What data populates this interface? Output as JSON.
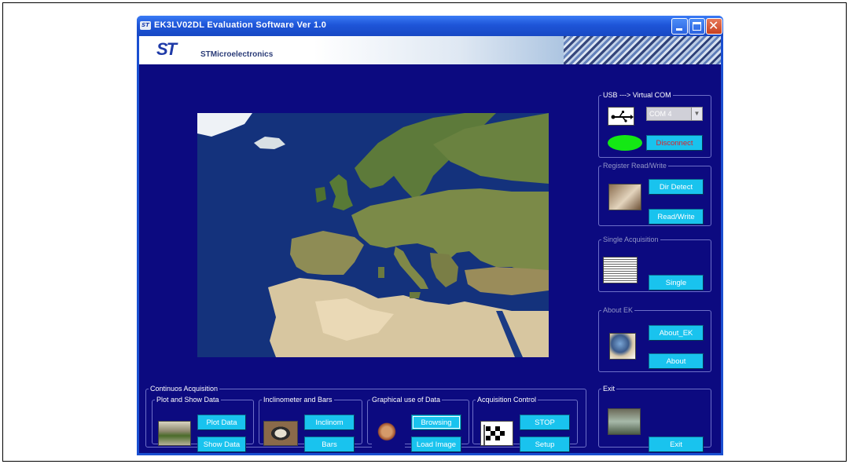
{
  "window": {
    "title": "EK3LV02DL Evaluation Software Ver 1.0",
    "app_icon_text": "ST"
  },
  "banner": {
    "logo_text": "ST",
    "company": "STMicroelectronics"
  },
  "usb": {
    "legend": "USB ---> Virtual COM",
    "port_value": "COM 4",
    "disconnect_label": "Disconnect",
    "status_color": "#14e814"
  },
  "register": {
    "legend": "Register Read/Write",
    "dir_detect_label": "Dir Detect",
    "read_write_label": "Read/Write"
  },
  "single": {
    "legend": "Single Acquisition",
    "single_label": "Single"
  },
  "about": {
    "legend": "About EK",
    "about_ek_label": "About_EK",
    "about_label": "About"
  },
  "exit": {
    "legend": "Exit",
    "exit_label": "Exit"
  },
  "continuous": {
    "legend": "Continuos Acquisition",
    "plot": {
      "legend": "Plot and Show Data",
      "plot_label": "Plot Data",
      "show_label": "Show Data"
    },
    "inclin": {
      "legend": "Inclinometer and Bars",
      "inclinom_label": "Inclinom",
      "bars_label": "Bars"
    },
    "graph": {
      "legend": "Graphical use of Data",
      "browsing_label": "Browsing",
      "load_label": "Load Image"
    },
    "acq": {
      "legend": "Acquisition Control",
      "stop_label": "STOP",
      "setup_label": "Setup"
    }
  },
  "colors": {
    "client_bg": "#0c0a80",
    "button_bg": "#19c3ee",
    "title_bar": "#1e55d8"
  }
}
